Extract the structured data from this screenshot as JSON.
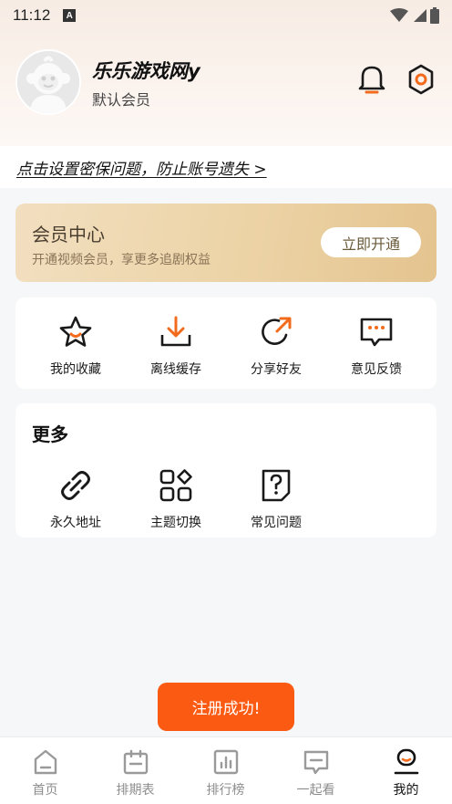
{
  "status_bar": {
    "time": "11:12",
    "notif_badge": "A"
  },
  "profile": {
    "username": "乐乐游戏网y",
    "level": "默认会员"
  },
  "security": {
    "link_text": "点击设置密保问题，防止账号遗失 >"
  },
  "vip": {
    "title": "会员中心",
    "subtitle": "开通视频会员，享更多追剧权益",
    "button": "立即开通"
  },
  "quick_actions": [
    {
      "label": "我的收藏",
      "icon": "star-icon"
    },
    {
      "label": "离线缓存",
      "icon": "download-icon"
    },
    {
      "label": "分享好友",
      "icon": "share-icon"
    },
    {
      "label": "意见反馈",
      "icon": "feedback-icon"
    }
  ],
  "more": {
    "title": "更多",
    "items": [
      {
        "label": "永久地址",
        "icon": "link-icon"
      },
      {
        "label": "主题切换",
        "icon": "theme-icon"
      },
      {
        "label": "常见问题",
        "icon": "faq-icon"
      }
    ]
  },
  "toast": {
    "text": "注册成功!"
  },
  "bottom_nav": [
    {
      "label": "首页",
      "icon": "home-icon"
    },
    {
      "label": "排期表",
      "icon": "calendar-icon"
    },
    {
      "label": "排行榜",
      "icon": "ranking-icon"
    },
    {
      "label": "一起看",
      "icon": "watch-together-icon"
    },
    {
      "label": "我的",
      "icon": "profile-icon",
      "active": true
    }
  ],
  "colors": {
    "accent": "#f26b1d",
    "toast": "#fb5a12",
    "vip_gold": "#e8cc99"
  }
}
